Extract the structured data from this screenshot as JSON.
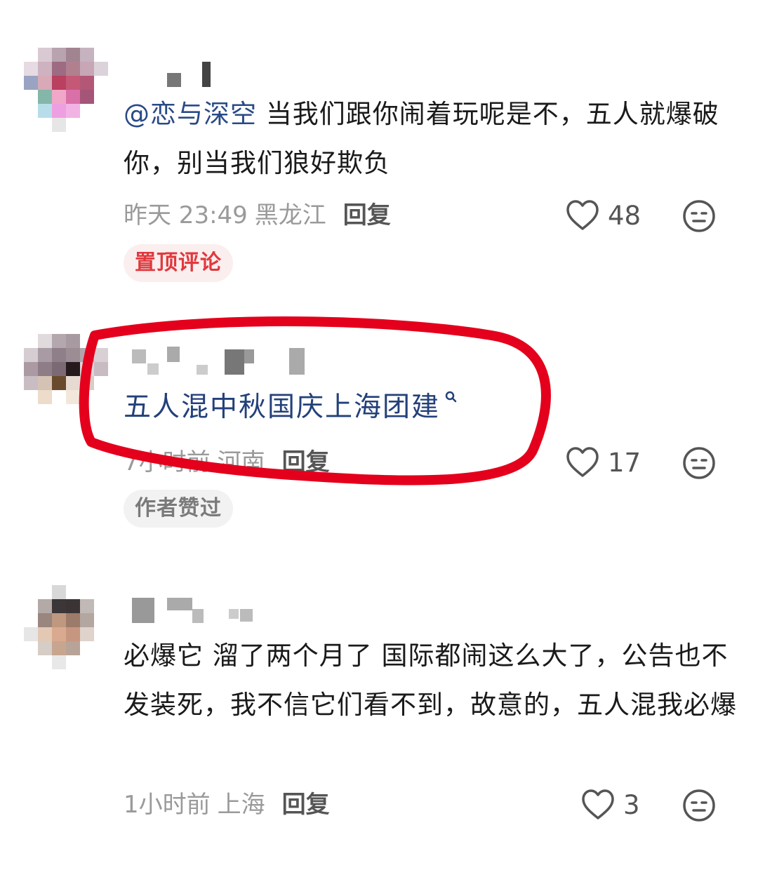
{
  "comments": [
    {
      "mention": "@恋与深空",
      "text": " 当我们跟你闹着玩呢是不，五人就爆破你，别当我们狼好欺负",
      "time": "昨天 23:49",
      "location": "黑龙江",
      "reply_label": "回复",
      "likes": "48",
      "tag": "置顶评论"
    },
    {
      "link_text": "五人混中秋国庆上海团建",
      "time": "7小时前",
      "location": "河南",
      "reply_label": "回复",
      "likes": "17",
      "tag": "作者赞过"
    },
    {
      "text": "必爆它 溜了两个月了 国际都闹这么大了，公告也不发装死，我不信它们看不到，故意的，五人混我必爆",
      "time": "1小时前",
      "location": "上海",
      "reply_label": "回复",
      "likes": "3"
    }
  ],
  "colors": {
    "accent_red": "#e0393e",
    "mention_blue": "#2a4a86",
    "annotation_red": "#e4001c"
  }
}
